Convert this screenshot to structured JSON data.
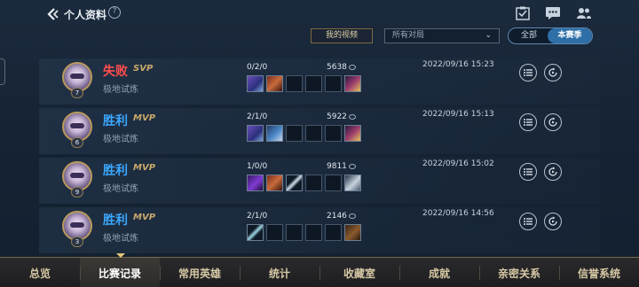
{
  "header": {
    "title": "个人资料",
    "help_glyph": "?"
  },
  "filters": {
    "my_videos_label": "我的视频",
    "dropdown_value": "所有对局",
    "segment_all": "全部",
    "segment_season": "本赛季"
  },
  "matches": [
    {
      "result": "失败",
      "outcome": "lose",
      "badge": "SVP",
      "mode": "极地试炼",
      "level": "7",
      "kda": "0/2/0",
      "gold": "5638",
      "date": "2022/09/16 15:23",
      "items": [
        "i-purple",
        "i-red",
        "",
        "",
        "",
        "i-gold"
      ]
    },
    {
      "result": "胜利",
      "outcome": "win",
      "badge": "MVP",
      "mode": "极地试炼",
      "level": "6",
      "kda": "2/1/0",
      "gold": "5922",
      "date": "2022/09/16 15:13",
      "items": [
        "i-purple",
        "i-blue",
        "",
        "",
        "",
        "i-gold"
      ]
    },
    {
      "result": "胜利",
      "outcome": "win",
      "badge": "MVP",
      "mode": "极地试炼",
      "level": "9",
      "kda": "1/0/0",
      "gold": "9811",
      "date": "2022/09/16 15:02",
      "items": [
        "i-violet",
        "i-red",
        "i-slash",
        "",
        "",
        "i-wolf"
      ]
    },
    {
      "result": "胜利",
      "outcome": "win",
      "badge": "MVP",
      "mode": "极地试炼",
      "level": "3",
      "kda": "2/1/0",
      "gold": "2146",
      "date": "2022/09/16 14:56",
      "items": [
        "i-teal",
        "",
        "",
        "",
        "",
        "i-brown"
      ]
    }
  ],
  "nav": [
    "总览",
    "比赛记录",
    "常用英雄",
    "统计",
    "收藏室",
    "成就",
    "亲密关系",
    "信誉系统"
  ],
  "nav_active": "比赛记录",
  "colors": {
    "win": "#3ba8ff",
    "lose": "#ff4d4d",
    "badge": "#c9a86a",
    "accent": "#2f6fa8"
  }
}
